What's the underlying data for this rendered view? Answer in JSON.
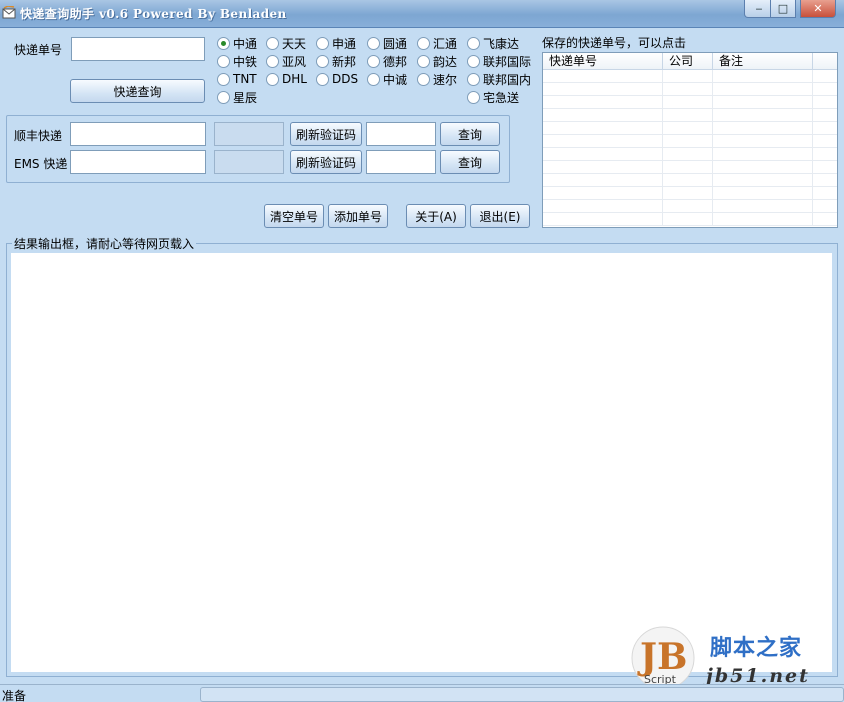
{
  "window": {
    "title": "快递查询助手 v0.6 Powered By Benladen",
    "minimize_symbol": "‒",
    "maximize_symbol": "□",
    "close_symbol": "✕"
  },
  "query": {
    "tracking_label": "快递单号",
    "tracking_value": "",
    "query_button": "快递查询"
  },
  "carriers": [
    {
      "label": "中通",
      "selected": true
    },
    {
      "label": "天天",
      "selected": false
    },
    {
      "label": "申通",
      "selected": false
    },
    {
      "label": "圆通",
      "selected": false
    },
    {
      "label": "汇通",
      "selected": false
    },
    {
      "label": "飞康达",
      "selected": false
    },
    {
      "label": "中铁",
      "selected": false
    },
    {
      "label": "亚风",
      "selected": false
    },
    {
      "label": "新邦",
      "selected": false
    },
    {
      "label": "德邦",
      "selected": false
    },
    {
      "label": "韵达",
      "selected": false
    },
    {
      "label": "联邦国际",
      "selected": false
    },
    {
      "label": "TNT",
      "selected": false
    },
    {
      "label": "DHL",
      "selected": false
    },
    {
      "label": "DDS",
      "selected": false
    },
    {
      "label": "中诚",
      "selected": false
    },
    {
      "label": "速尔",
      "selected": false
    },
    {
      "label": "联邦国内",
      "selected": false
    },
    {
      "label": "星辰",
      "selected": false
    },
    {
      "label": "宅急送",
      "selected": false
    }
  ],
  "captcha": {
    "sf_label": "顺丰快递",
    "ems_label": "EMS 快递",
    "refresh_button": "刷新验证码",
    "query_button": "查询"
  },
  "actions": {
    "clear": "清空单号",
    "add": "添加单号",
    "about": "关于(A)",
    "exit": "退出(E)"
  },
  "saved": {
    "heading": "保存的快递单号，可以点击",
    "columns": [
      "快递单号",
      "公司",
      "备注"
    ]
  },
  "result": {
    "legend": "结果输出框，请耐心等待网页载入"
  },
  "status": {
    "text": "准备"
  },
  "watermark": {
    "cn": "脚本之家",
    "url": "jb51.net",
    "script": "Script",
    "logo": "JB"
  }
}
